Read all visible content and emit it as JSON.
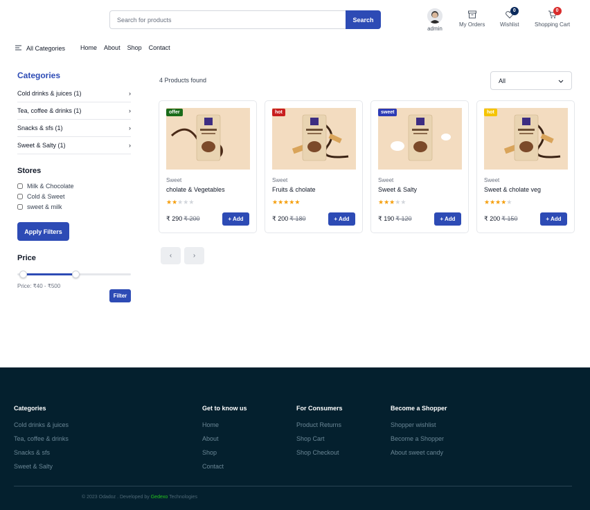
{
  "header": {
    "search_placeholder": "Search for products",
    "search_button": "Search",
    "user_label": "admin",
    "orders_label": "My Orders",
    "wishlist_label": "Wishlist",
    "wishlist_count": "0",
    "cart_label": "Shopping Cart",
    "cart_count": "0"
  },
  "nav": {
    "all_categories": "All Categories",
    "links": [
      "Home",
      "About",
      "Shop",
      "Contact"
    ]
  },
  "sidebar": {
    "categories_title": "Categories",
    "categories": [
      "Cold drinks & juices (1)",
      "Tea, coffee & drinks (1)",
      "Snacks & sfs (1)",
      "Sweet & Salty (1)"
    ],
    "stores_title": "Stores",
    "stores": [
      "Milk & Chocolate",
      "Cold & Sweet",
      "sweet & milk"
    ],
    "apply_button": "Apply Filters",
    "price_title": "Price",
    "price_range": "Price: ₹40 - ₹500",
    "price_min_fraction": 0.05,
    "price_max_fraction": 0.52,
    "filter_button": "Filter"
  },
  "main": {
    "found_text": "4 Products found",
    "sort_value": "All",
    "products": [
      {
        "tag": "offer",
        "tag_color": "#1a6b1a",
        "category": "Sweet",
        "name": "cholate & Vegetables",
        "rating": 2,
        "price": "₹ 290",
        "old_price": "₹ 200",
        "add": "Add",
        "variant": "choco"
      },
      {
        "tag": "hot",
        "tag_color": "#c81e1e",
        "category": "Sweet",
        "name": "Fruits & cholate",
        "rating": 5,
        "price": "₹ 200",
        "old_price": "₹ 180",
        "add": "Add",
        "variant": "wafer"
      },
      {
        "tag": "sweet",
        "tag_color": "#2d3bb5",
        "category": "Sweet",
        "name": "Sweet & Salty",
        "rating": 3,
        "price": "₹ 190",
        "old_price": "₹ 120",
        "add": "Add",
        "variant": "milk"
      },
      {
        "tag": "hot",
        "tag_color": "#f5c400",
        "category": "Sweet",
        "name": "Sweet & cholate veg",
        "rating": 4,
        "price": "₹ 200",
        "old_price": "₹ 150",
        "add": "Add",
        "variant": "wafer"
      }
    ],
    "pager_prev": "‹",
    "pager_next": "›"
  },
  "footer": {
    "columns": [
      {
        "title": "Categories",
        "links": [
          "Cold drinks & juices",
          "Tea, coffee & drinks",
          "Snacks & sfs",
          "Sweet & Salty"
        ]
      },
      {
        "title": "Get to know us",
        "links": [
          "Home",
          "About",
          "Shop",
          "Contact"
        ]
      },
      {
        "title": "For Consumers",
        "links": [
          "Product Returns",
          "Shop Cart",
          "Shop Checkout"
        ]
      },
      {
        "title": "Become a Shopper",
        "links": [
          "Shopper wishlist",
          "Become a Shopper",
          "About sweet candy"
        ]
      }
    ],
    "copyright_prefix": "© 2023 Odadoz . Developed by ",
    "copyright_brand": "Gedexo",
    "copyright_suffix": " Technologies"
  }
}
